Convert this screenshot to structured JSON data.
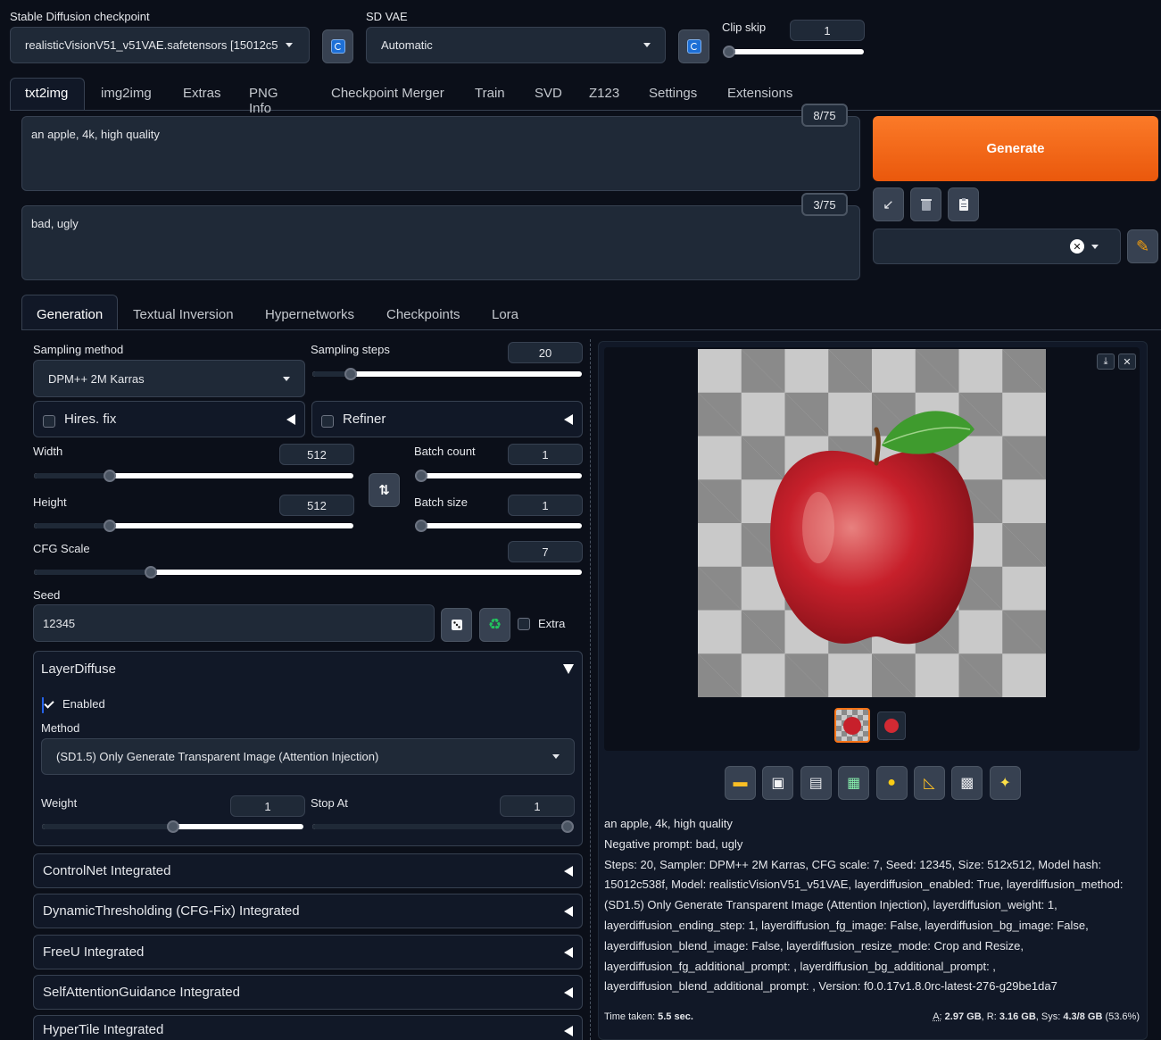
{
  "top": {
    "checkpoint_label": "Stable Diffusion checkpoint",
    "checkpoint_value": "realisticVisionV51_v51VAE.safetensors [15012c5",
    "vae_label": "SD VAE",
    "vae_value": "Automatic",
    "clip_skip_label": "Clip skip",
    "clip_skip_value": "1",
    "clip_skip_fraction": 0.0
  },
  "main_tabs": [
    "txt2img",
    "img2img",
    "Extras",
    "PNG Info",
    "Checkpoint Merger",
    "Train",
    "SVD",
    "Z123",
    "Settings",
    "Extensions"
  ],
  "prompt": {
    "text": "an apple, 4k, high quality",
    "counter": "8/75"
  },
  "negative": {
    "text": "bad, ugly",
    "counter": "3/75"
  },
  "generate_label": "Generate",
  "sub_tabs": [
    "Generation",
    "Textual Inversion",
    "Hypernetworks",
    "Checkpoints",
    "Lora"
  ],
  "sampling": {
    "method_label": "Sampling method",
    "method_value": "DPM++ 2M Karras",
    "steps_label": "Sampling steps",
    "steps_value": "20"
  },
  "hires_label": "Hires. fix",
  "refiner_label": "Refiner",
  "width": {
    "label": "Width",
    "value": "512"
  },
  "height": {
    "label": "Height",
    "value": "512"
  },
  "batch_count": {
    "label": "Batch count",
    "value": "1"
  },
  "batch_size": {
    "label": "Batch size",
    "value": "1"
  },
  "cfg": {
    "label": "CFG Scale",
    "value": "7"
  },
  "seed": {
    "label": "Seed",
    "value": "12345",
    "extra_label": "Extra"
  },
  "layerdiffuse": {
    "title": "LayerDiffuse",
    "enabled_label": "Enabled",
    "method_label": "Method",
    "method_value": "(SD1.5) Only Generate Transparent Image (Attention Injection)",
    "weight_label": "Weight",
    "weight_value": "1",
    "stop_label": "Stop At",
    "stop_value": "1"
  },
  "accordions": [
    "ControlNet Integrated",
    "DynamicThresholding (CFG-Fix) Integrated",
    "FreeU Integrated",
    "SelfAttentionGuidance Integrated",
    "HyperTile Integrated"
  ],
  "output": {
    "line1": "an apple, 4k, high quality",
    "line2": "Negative prompt: bad, ugly",
    "params": [
      "Steps: 20, Sampler: DPM++ 2M Karras, CFG scale: 7, Seed: 12345, Size: 512x512, Model hash:",
      "15012c538f, Model: realisticVisionV51_v51VAE, layerdiffusion_enabled: True, layerdiffusion_method:",
      "(SD1.5) Only Generate Transparent Image (Attention Injection), layerdiffusion_weight: 1,",
      "layerdiffusion_ending_step: 1, layerdiffusion_fg_image: False, layerdiffusion_bg_image: False,",
      "layerdiffusion_blend_image: False, layerdiffusion_resize_mode: Crop and Resize,",
      "layerdiffusion_fg_additional_prompt: , layerdiffusion_bg_additional_prompt: ,",
      "layerdiffusion_blend_additional_prompt: , Version: f0.0.17v1.8.0rc-latest-276-g29be1da7"
    ],
    "time_label": "Time taken:",
    "time_value": "5.5 sec.",
    "mem_a_label": "A:",
    "mem_a_value": "2.97 GB",
    "mem_r_label": ", R:",
    "mem_r_value": "3.16 GB",
    "mem_sys_label": ", Sys:",
    "mem_sys_value": "4.3/8 GB",
    "mem_pct": "(53.6%)"
  },
  "colors": {
    "accent": "#f97316",
    "bg": "#0b0f19",
    "panel": "#111827",
    "input": "#1f2937"
  }
}
